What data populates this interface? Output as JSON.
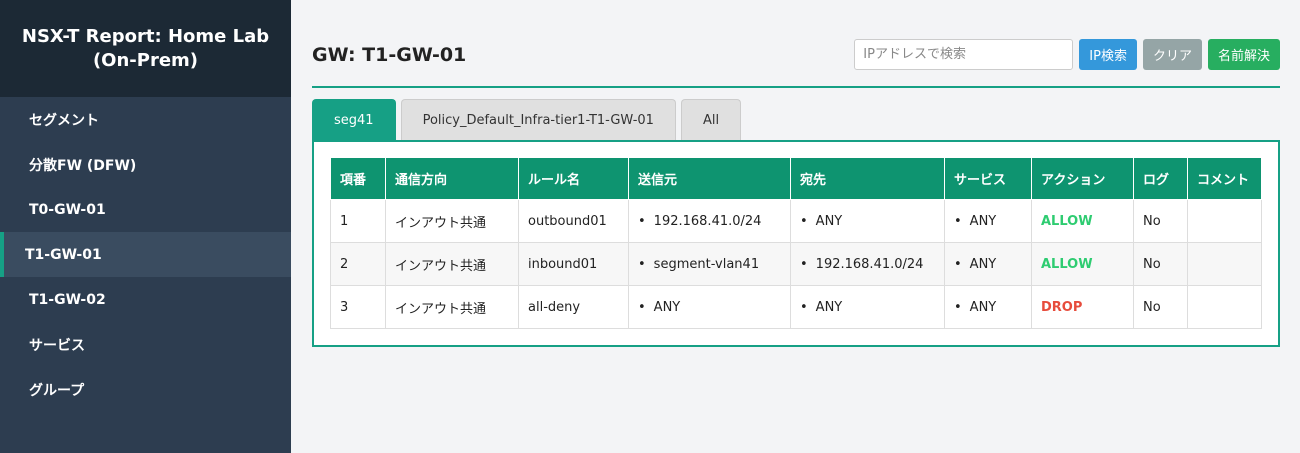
{
  "sidebar": {
    "title_line1": "NSX-T Report: Home Lab",
    "title_line2": "(On-Prem)",
    "items": [
      {
        "label": "セグメント"
      },
      {
        "label": "分散FW (DFW)"
      },
      {
        "label": "T0-GW-01"
      },
      {
        "label": "T1-GW-01"
      },
      {
        "label": "T1-GW-02"
      },
      {
        "label": "サービス"
      },
      {
        "label": "グループ"
      }
    ],
    "active_item": "T1-GW-01"
  },
  "header": {
    "title": "GW: T1-GW-01",
    "search_placeholder": "IPアドレスで検索",
    "search_value": "",
    "ip_search_label": "IP検索",
    "clear_label": "クリア",
    "resolve_label": "名前解決"
  },
  "tabs": [
    {
      "label": "seg41",
      "active": true
    },
    {
      "label": "Policy_Default_Infra-tier1-T1-GW-01",
      "active": false
    },
    {
      "label": "All",
      "active": false
    }
  ],
  "table": {
    "headers": [
      "項番",
      "通信方向",
      "ルール名",
      "送信元",
      "宛先",
      "サービス",
      "アクション",
      "ログ",
      "コメント"
    ],
    "rows": [
      {
        "no": "1",
        "direction": "インアウト共通",
        "rule": "outbound01",
        "source": "192.168.41.0/24",
        "dest": "ANY",
        "service": "ANY",
        "action": "ALLOW",
        "log": "No",
        "comment": ""
      },
      {
        "no": "2",
        "direction": "インアウト共通",
        "rule": "inbound01",
        "source": "segment-vlan41",
        "dest": "192.168.41.0/24",
        "service": "ANY",
        "action": "ALLOW",
        "log": "No",
        "comment": ""
      },
      {
        "no": "3",
        "direction": "インアウト共通",
        "rule": "all-deny",
        "source": "ANY",
        "dest": "ANY",
        "service": "ANY",
        "action": "DROP",
        "log": "No",
        "comment": ""
      }
    ]
  },
  "colors": {
    "accent": "#16a085",
    "header_bg": "#0e9470",
    "allow": "#2ecc71",
    "drop": "#e74c3c"
  }
}
